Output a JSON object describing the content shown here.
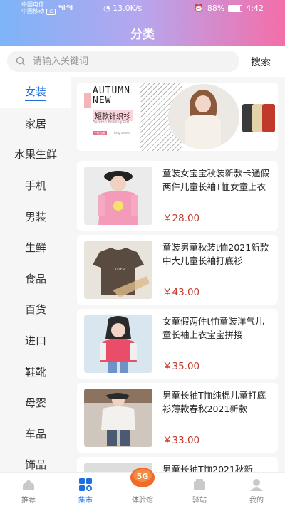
{
  "status_bar": {
    "carrier1": "中国电信",
    "carrier2": "中国移动",
    "hd": "HD",
    "signal": "⁴⁶ıll ⁴⁶ıll",
    "speed": "13.0K/s",
    "battery": "88%",
    "time": "4:42"
  },
  "header": {
    "title": "分类"
  },
  "search": {
    "placeholder": "请输入关键词",
    "value": "",
    "button_label": "搜索"
  },
  "sidebar": {
    "items": [
      {
        "label": "女装",
        "active": true
      },
      {
        "label": "家居"
      },
      {
        "label": "水果生鲜"
      },
      {
        "label": "手机"
      },
      {
        "label": "男装"
      },
      {
        "label": "生鲜"
      },
      {
        "label": "食品"
      },
      {
        "label": "百货"
      },
      {
        "label": "进口"
      },
      {
        "label": "鞋靴"
      },
      {
        "label": "母婴"
      },
      {
        "label": "车品"
      },
      {
        "label": "饰品"
      }
    ]
  },
  "banner": {
    "line1": "AUTUMN",
    "line2": "NEW",
    "subtitle": "短款针织衫",
    "tiny": "Autumn Knitting Girl",
    "tag": "一件包邮",
    "tag2": "long sleeve",
    "accent_color": "#f3b5b5"
  },
  "products": [
    {
      "title": "童装女宝宝秋装新款卡通假两件儿童长袖T恤女童上衣",
      "price": "￥28.00"
    },
    {
      "title": "童装男童秋装t恤2021新款中大儿童长袖打底衫",
      "price": "￥43.00"
    },
    {
      "title": "女童假两件t恤童装洋气儿童长袖上衣宝宝拼接",
      "price": "￥35.00"
    },
    {
      "title": "男童长袖T恤纯棉儿童打底衫薄款春秋2021新款",
      "price": "￥33.00"
    },
    {
      "title": "男童长袖T恤2021秋新",
      "price": ""
    }
  ],
  "tabbar": {
    "items": [
      {
        "label": "推荐",
        "icon": "home-icon"
      },
      {
        "label": "集市",
        "icon": "market-icon",
        "active": true
      },
      {
        "label": "体验馆",
        "icon": "5g-icon",
        "badge": "5G"
      },
      {
        "label": "驿站",
        "icon": "station-icon"
      },
      {
        "label": "我的",
        "icon": "profile-icon"
      }
    ]
  },
  "colors": {
    "accent": "#1e6fe0",
    "price": "#c0392b",
    "header_start": "#7db4f8",
    "header_end": "#f46ea8"
  }
}
